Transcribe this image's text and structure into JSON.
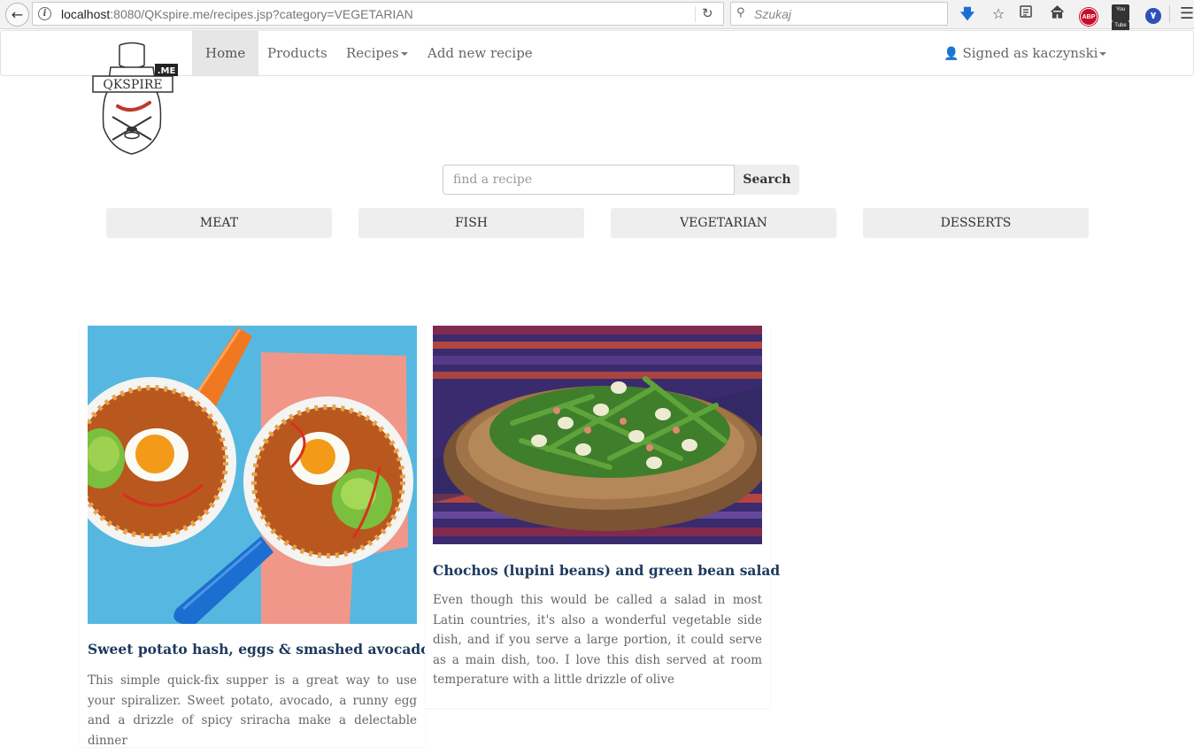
{
  "browser": {
    "url_host": "localhost",
    "url_rest": ":8080/QKspire.me/recipes.jsp?category=VEGETARIAN",
    "search_placeholder": "Szukaj",
    "abp_label": "ABP",
    "yt_label_top": "You",
    "yt_label_bottom": "Tube"
  },
  "navbar": {
    "home": "Home",
    "products": "Products",
    "recipes": "Recipes",
    "add_recipe": "Add new recipe",
    "user": "Signed as kaczynski"
  },
  "logo": {
    "brand": "QKSPIRE",
    "suffix": ".ME"
  },
  "search": {
    "placeholder": "find a recipe",
    "button": "Search"
  },
  "categories": [
    "MEAT",
    "FISH",
    "VEGETARIAN",
    "DESSERTS"
  ],
  "recipes": [
    {
      "title": "Sweet potato hash, eggs & smashed avocado",
      "description": "This simple quick-fix supper is a great way to use your spiralizer. Sweet potato, avocado, a runny egg and a drizzle of spicy sriracha make a delectable dinner"
    },
    {
      "title": "Chochos (lupini beans) and green bean salad",
      "description": "Even though this would be called a salad in most Latin countries, it's also a wonderful vegetable side dish, and if you serve a large portion, it could serve as a main dish, too. I love this dish served at room temperature with a little drizzle of olive"
    }
  ]
}
